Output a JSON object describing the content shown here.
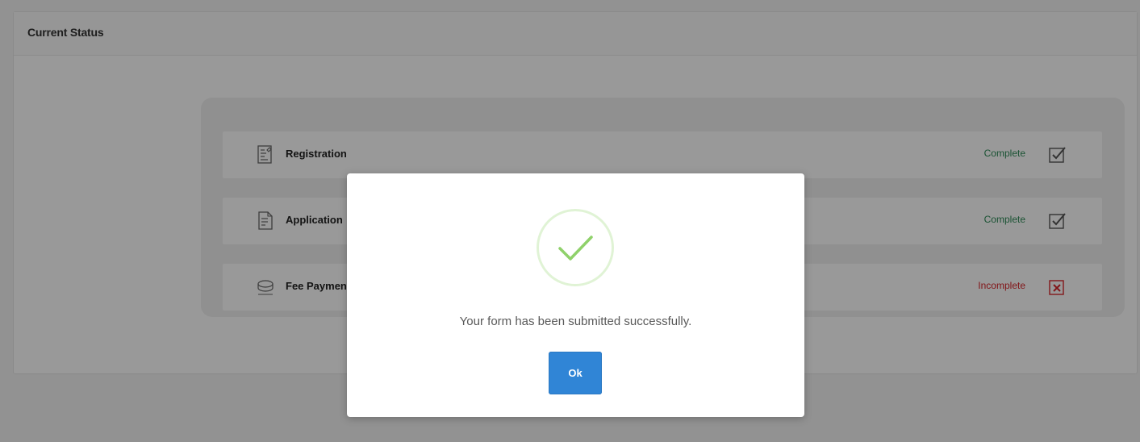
{
  "card": {
    "title": "Current Status"
  },
  "steps": [
    {
      "label": "Registration",
      "status": "Complete",
      "icon": "registration-form-icon",
      "status_icon": "checked-box-icon"
    },
    {
      "label": "Application",
      "status": "Complete",
      "icon": "application-document-icon",
      "status_icon": "checked-box-icon"
    },
    {
      "label": "Fee Payment",
      "status": "Incomplete",
      "icon": "fee-payment-icon",
      "status_icon": "crossed-box-icon"
    }
  ],
  "modal": {
    "message": "Your form has been submitted successfully.",
    "ok_label": "Ok",
    "icon": "success-checkmark-icon"
  },
  "colors": {
    "complete": "#2e8b57",
    "incomplete": "#d9262b",
    "success_check": "#8fd16a",
    "ok_button": "#3085d6"
  }
}
